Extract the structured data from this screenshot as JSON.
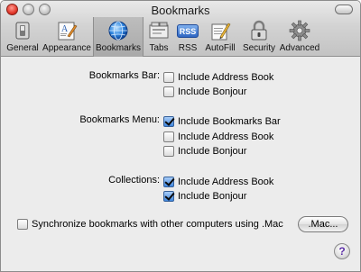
{
  "window": {
    "title": "Bookmarks"
  },
  "toolbar": {
    "items": [
      {
        "label": "General",
        "icon": "general-switch-icon"
      },
      {
        "label": "Appearance",
        "icon": "appearance-icon"
      },
      {
        "label": "Bookmarks",
        "icon": "globe-icon",
        "selected": true
      },
      {
        "label": "Tabs",
        "icon": "tabs-icon"
      },
      {
        "label": "RSS",
        "icon": "rss-icon"
      },
      {
        "label": "AutoFill",
        "icon": "pencil-icon"
      },
      {
        "label": "Security",
        "icon": "lock-icon"
      },
      {
        "label": "Advanced",
        "icon": "gear-icon"
      }
    ],
    "rss_badge": "RSS"
  },
  "bookmarks_bar": {
    "label": "Bookmarks Bar:",
    "options": [
      {
        "label": "Include Address Book",
        "checked": false
      },
      {
        "label": "Include Bonjour",
        "checked": false
      }
    ]
  },
  "bookmarks_menu": {
    "label": "Bookmarks Menu:",
    "options": [
      {
        "label": "Include Bookmarks Bar",
        "checked": true
      },
      {
        "label": "Include Address Book",
        "checked": false
      },
      {
        "label": "Include Bonjour",
        "checked": false
      }
    ]
  },
  "collections": {
    "label": "Collections:",
    "options": [
      {
        "label": "Include Address Book",
        "checked": true
      },
      {
        "label": "Include Bonjour",
        "checked": true
      }
    ]
  },
  "sync": {
    "label": "Synchronize bookmarks with other computers using .Mac",
    "checked": false,
    "button_label": ".Mac..."
  },
  "help": {
    "label": "?"
  },
  "colors": {
    "accent": "#3f86df",
    "window_bg": "#ececec",
    "help_glyph": "#5b2ea6"
  }
}
